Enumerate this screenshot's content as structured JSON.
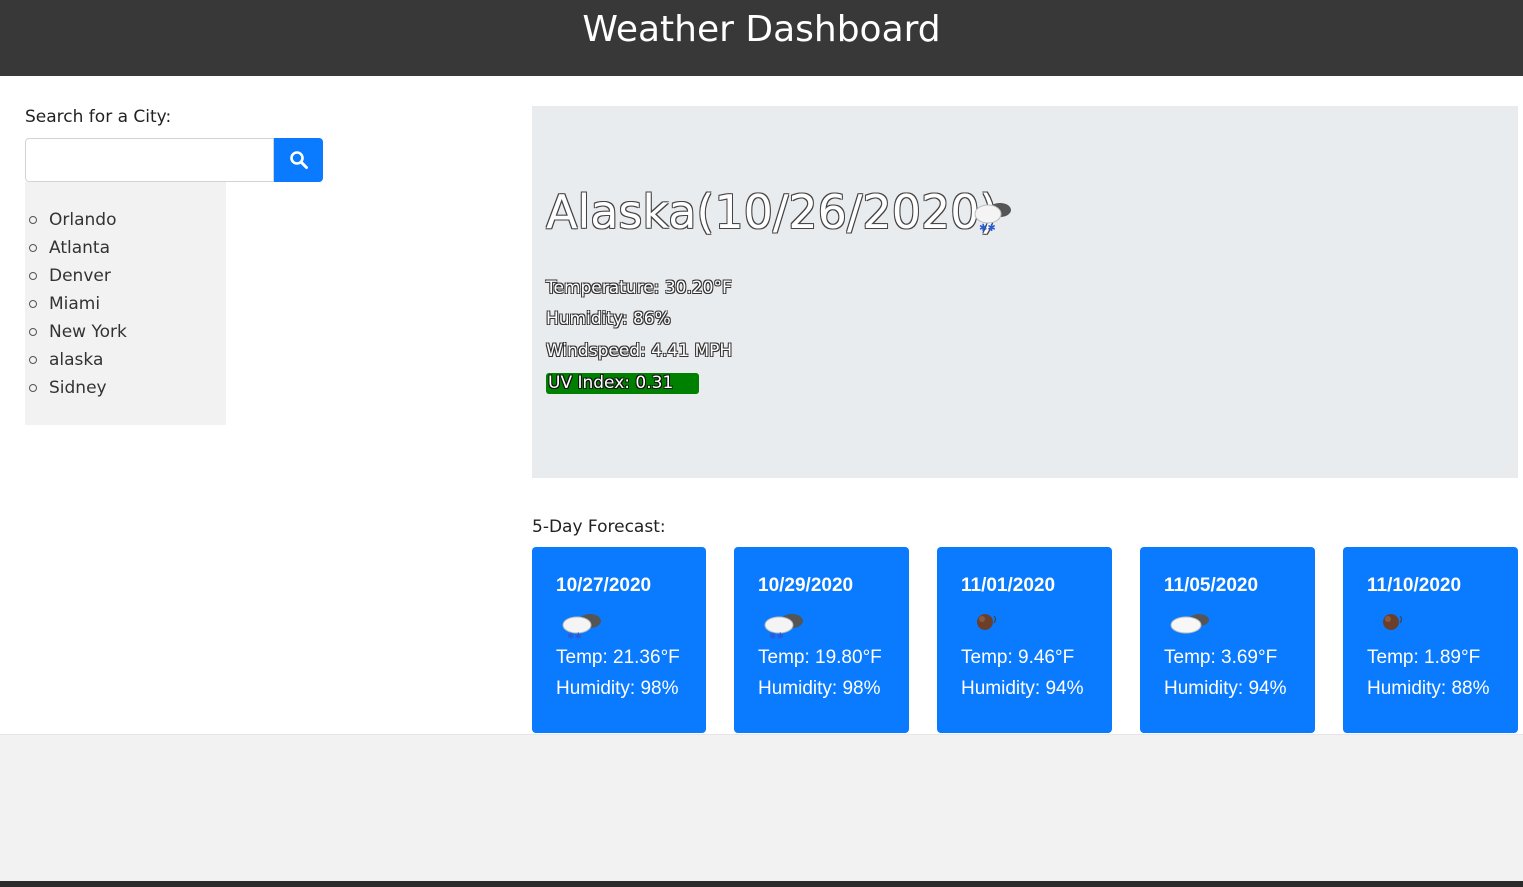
{
  "header": {
    "title": "Weather Dashboard"
  },
  "search": {
    "label": "Search for a City:",
    "input_value": "",
    "button_icon": "search-icon"
  },
  "history": [
    "Orlando",
    "Atlanta",
    "Denver",
    "Miami",
    "New York",
    "alaska",
    "Sidney"
  ],
  "current": {
    "title": "Alaska(10/26/2020)",
    "icon": "snow-cloud-icon",
    "temperature": "Temperature: 30.20°F",
    "humidity": "Humidity: 86%",
    "windspeed": "Windspeed: 4.41 MPH",
    "uv": "UV Index: 0.31",
    "uv_color": "#008000"
  },
  "forecast": {
    "label": "5-Day Forecast:",
    "days": [
      {
        "date": "10/27/2020",
        "icon": "snow-cloud-icon",
        "temp": "Temp: 21.36°F",
        "humidity": "Humidity: 98%"
      },
      {
        "date": "10/29/2020",
        "icon": "snow-cloud-icon",
        "temp": "Temp: 19.80°F",
        "humidity": "Humidity: 98%"
      },
      {
        "date": "11/01/2020",
        "icon": "clear-night-icon",
        "temp": "Temp: 9.46°F",
        "humidity": "Humidity: 94%"
      },
      {
        "date": "11/05/2020",
        "icon": "cloudy-icon",
        "temp": "Temp: 3.69°F",
        "humidity": "Humidity: 94%"
      },
      {
        "date": "11/10/2020",
        "icon": "clear-night-icon",
        "temp": "Temp: 1.89°F",
        "humidity": "Humidity: 88%"
      }
    ]
  },
  "colors": {
    "header_bg": "#383838",
    "accent": "#0a7bff",
    "panel_bg": "#e9ecef"
  }
}
